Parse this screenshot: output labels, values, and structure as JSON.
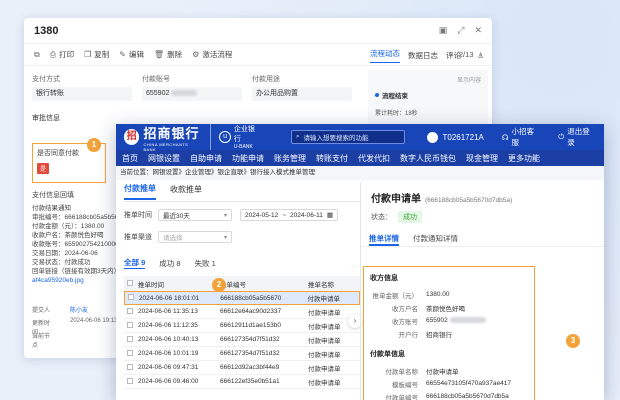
{
  "back_window": {
    "title": "1380",
    "win_icons": [
      "layout-icon",
      "expand-icon",
      "close-icon"
    ],
    "toolbar": [
      {
        "icon": "save-icon",
        "label": ""
      },
      {
        "icon": "print-icon",
        "label": "打印"
      },
      {
        "icon": "copy-icon",
        "label": "复制"
      },
      {
        "icon": "edit-icon",
        "label": "编辑"
      },
      {
        "icon": "delete-icon",
        "label": "删除"
      },
      {
        "icon": "flow-icon",
        "label": "激活流程"
      }
    ],
    "pager": "2/13",
    "side_tabs": [
      "流程动态",
      "数据日志",
      "评论"
    ],
    "fields": [
      {
        "label": "支付方式",
        "value": "银行转账"
      },
      {
        "label": "付款账号",
        "value": "655902"
      },
      {
        "label": "付款用途",
        "value": "办公用品购置"
      }
    ],
    "section": "审批信息",
    "highlight": {
      "label": "是否同意付款",
      "tag": "是"
    },
    "notice": {
      "title": "支付信息回填",
      "lines": [
        "付款结果通知",
        "审批编号：666188cb05a5b5670",
        "付款金额（元）：1380.00",
        "收款户名：茶颜悦色好喝",
        "收款账号：655902754210000",
        "交易日期：2024-06-06",
        "交易状态：付款成功",
        "回单链接（链接有效期3天内）"
      ],
      "link": "af4ca95920eb.jpg"
    },
    "meta": [
      {
        "k": "提交人",
        "v": "陈小友",
        "link": true
      },
      {
        "k": "更新时间",
        "v": "2024-06-06 19:13:09",
        "link": false
      },
      {
        "k": "当前节点",
        "v": "",
        "link": false
      }
    ],
    "right_panel": {
      "top_link": "显示内容",
      "title": "流程结束",
      "line": "累计耗时：18秒"
    }
  },
  "badges": [
    "1",
    "2",
    "3"
  ],
  "front_window": {
    "logo": {
      "mark": "招",
      "name": "招商银行",
      "sub": "CHINA MERCHANTS BANK"
    },
    "ubank": {
      "line1": "企业银行",
      "line2": "U-BANK"
    },
    "search_placeholder": "请输入想要搜索的功能",
    "user": "T0261721A",
    "buttons": [
      "小招客服",
      "退出登录"
    ],
    "nav": [
      "首页",
      "网银设置",
      "自助申请",
      "功能申请",
      "账务管理",
      "转账支付",
      "代发代扣",
      "数字人民币钱包",
      "现金管理",
      "更多功能"
    ],
    "breadcrumb": "当前位置：网银设置》企业管理》银企直联》银行接入模式推单管理",
    "list": {
      "tabs": [
        "付款推单",
        "收款推单"
      ],
      "filters": {
        "time_label": "推单时间",
        "time_value": "最近30天",
        "date_from": "2024-05-12",
        "date_to": "2024-06-11",
        "channel_label": "推单渠道",
        "channel_placeholder": "请选择"
      },
      "status_tabs": [
        "全部 9",
        "成功 8",
        "失败 1"
      ],
      "headers": [
        "推单时间",
        "推单编号",
        "推单名称"
      ],
      "rows": [
        {
          "time": "2024-06-06 18:01:01",
          "no": "666188cb05a5b5670",
          "name": "付款申请单"
        },
        {
          "time": "2024-06-06 11:35:13",
          "no": "66612e64ac90d2337",
          "name": "付款申请单"
        },
        {
          "time": "2024-06-06 11:12:35",
          "no": "66612911d1ae153b0",
          "name": "付款申请单"
        },
        {
          "time": "2024-06-06 10:40:13",
          "no": "666127354d7f51d32",
          "name": "付款申请单"
        },
        {
          "time": "2024-06-06 10:01:19",
          "no": "666127354d7f51d32",
          "name": "付款申请单"
        },
        {
          "time": "2024-06-06 09:47:31",
          "no": "66612d92ac3bf44e9",
          "name": "付款申请单"
        },
        {
          "time": "2024-06-06 09:46:00",
          "no": "666122ef35e0b51a1",
          "name": "付款申请单"
        }
      ]
    },
    "detail": {
      "title": "付款申请单",
      "id": "(666188cb05a5b5670d7db5a)",
      "status_label": "状态：",
      "status": "成功",
      "tabs": [
        "推单详情",
        "付款通知详情"
      ],
      "section1": "收方信息",
      "kv1": [
        {
          "k": "推单金额（元）",
          "v": "1380.00"
        },
        {
          "k": "收方户名",
          "v": "茶颜悦色好喝"
        },
        {
          "k": "收方账号",
          "v": "655902"
        },
        {
          "k": "开户行",
          "v": "招商银行"
        }
      ],
      "section2": "付款单信息",
      "kv2": [
        {
          "k": "付款单名称",
          "v": "付款申请单"
        },
        {
          "k": "模板编号",
          "v": "66554e73105f470a937ae417"
        },
        {
          "k": "付款单编号",
          "v": "666188cb05a5b5670d7db5a"
        }
      ]
    }
  },
  "colors": {
    "bank_blue": "#1845b8",
    "accent_orange": "#f3a23a",
    "link_blue": "#1a66e6"
  }
}
